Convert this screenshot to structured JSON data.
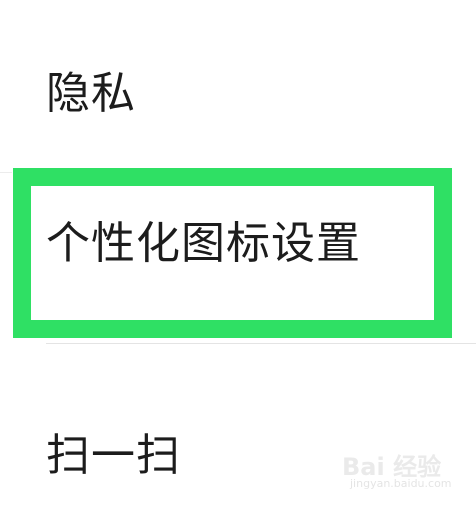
{
  "menu": {
    "privacy_label": "隐私",
    "icon_settings_label": "个性化图标设置",
    "scan_label": "扫一扫"
  },
  "annotation": {
    "highlight_color": "#2fe064"
  },
  "watermark": {
    "brand": "Bai 经验",
    "url": "jingyan.baidu.com"
  }
}
